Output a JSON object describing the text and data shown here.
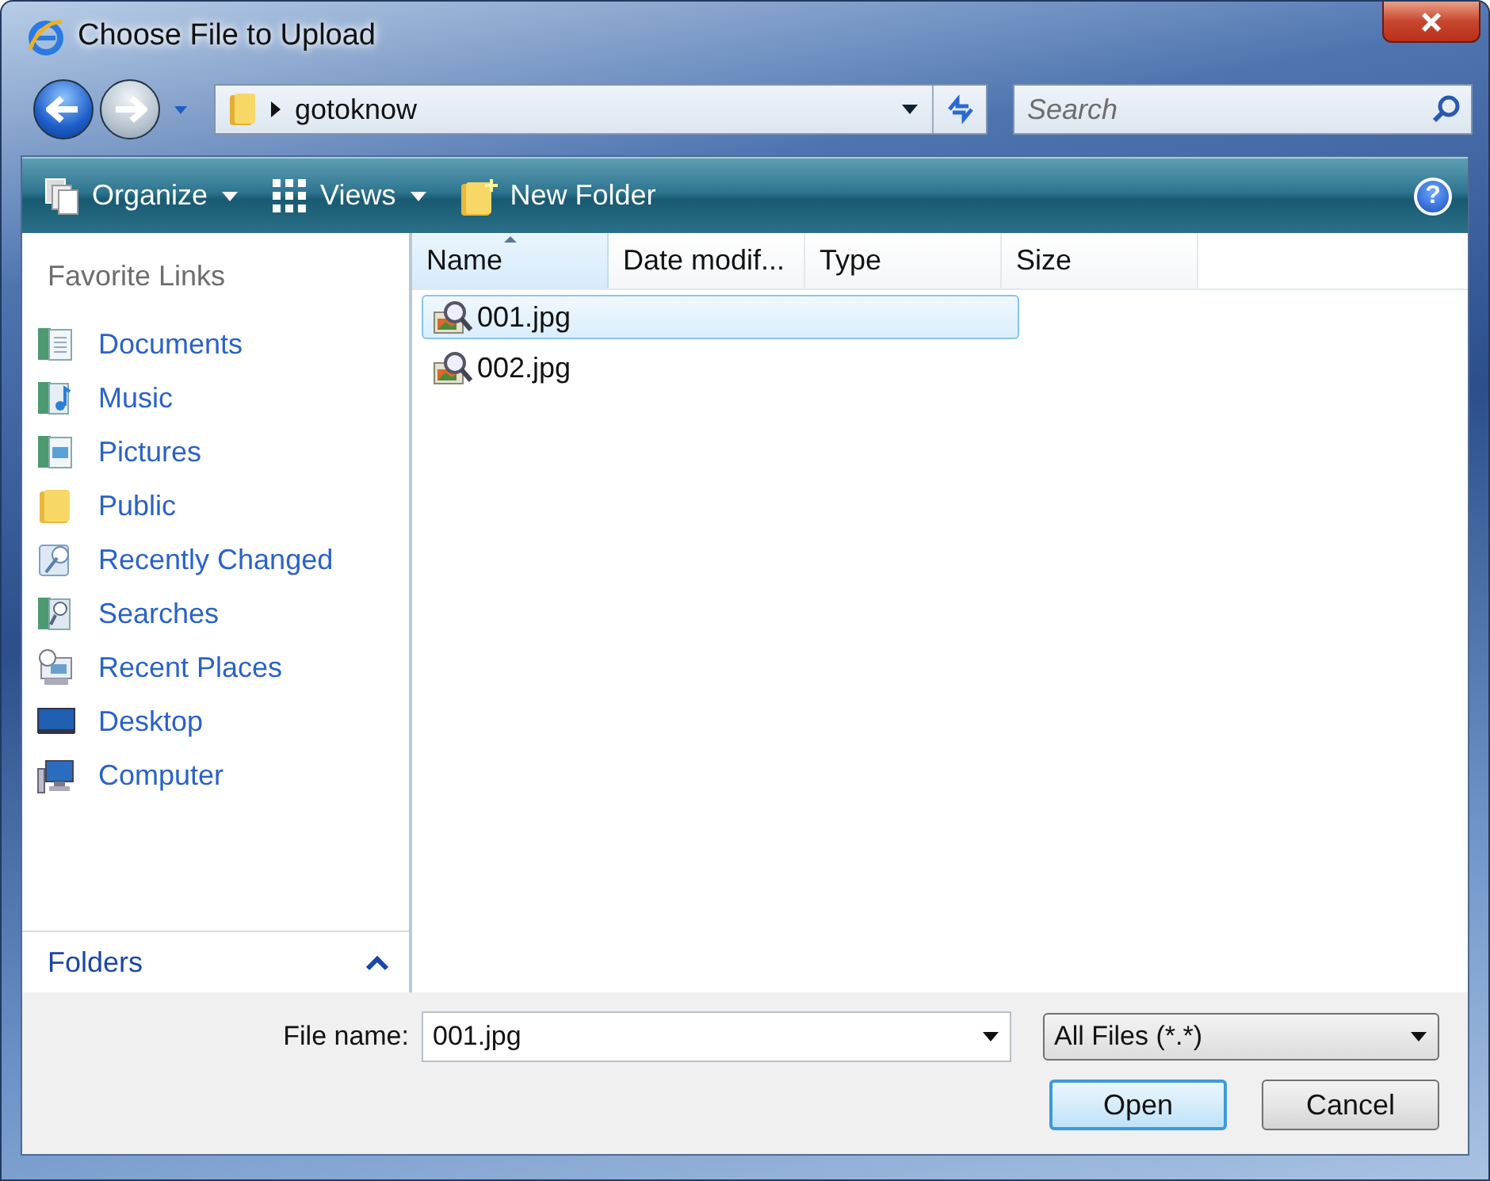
{
  "window": {
    "title": "Choose File to Upload"
  },
  "address": {
    "path": "gotoknow"
  },
  "search": {
    "placeholder": "Search"
  },
  "toolbar": {
    "items": [
      {
        "label": "Organize",
        "kind": "menu"
      },
      {
        "label": "Views",
        "kind": "menu"
      },
      {
        "label": "New Folder",
        "kind": "button"
      }
    ],
    "help": "?"
  },
  "sidebar": {
    "heading": "Favorite Links",
    "items": [
      {
        "label": "Documents",
        "kind": "documents"
      },
      {
        "label": "Music",
        "kind": "music"
      },
      {
        "label": "Pictures",
        "kind": "pictures"
      },
      {
        "label": "Public",
        "kind": "folder"
      },
      {
        "label": "Recently Changed",
        "kind": "recent"
      },
      {
        "label": "Searches",
        "kind": "searches"
      },
      {
        "label": "Recent Places",
        "kind": "places"
      },
      {
        "label": "Desktop",
        "kind": "desktop"
      },
      {
        "label": "Computer",
        "kind": "computer"
      }
    ],
    "folders": {
      "label": "Folders",
      "expanded": false
    }
  },
  "table": {
    "columns": [
      {
        "label": "Name",
        "sorted": true
      },
      {
        "label": "Date modif...",
        "sorted": false
      },
      {
        "label": "Type",
        "sorted": false
      },
      {
        "label": "Size",
        "sorted": false
      }
    ],
    "rows": [
      {
        "name": "001.jpg",
        "selected": true
      },
      {
        "name": "002.jpg",
        "selected": false
      }
    ]
  },
  "footer": {
    "file_name_label": "File name:",
    "file_name": "001.jpg",
    "file_type": "All Files (*.*)",
    "buttons": [
      {
        "label": "Open",
        "default": true
      },
      {
        "label": "Cancel",
        "default": false
      }
    ]
  }
}
